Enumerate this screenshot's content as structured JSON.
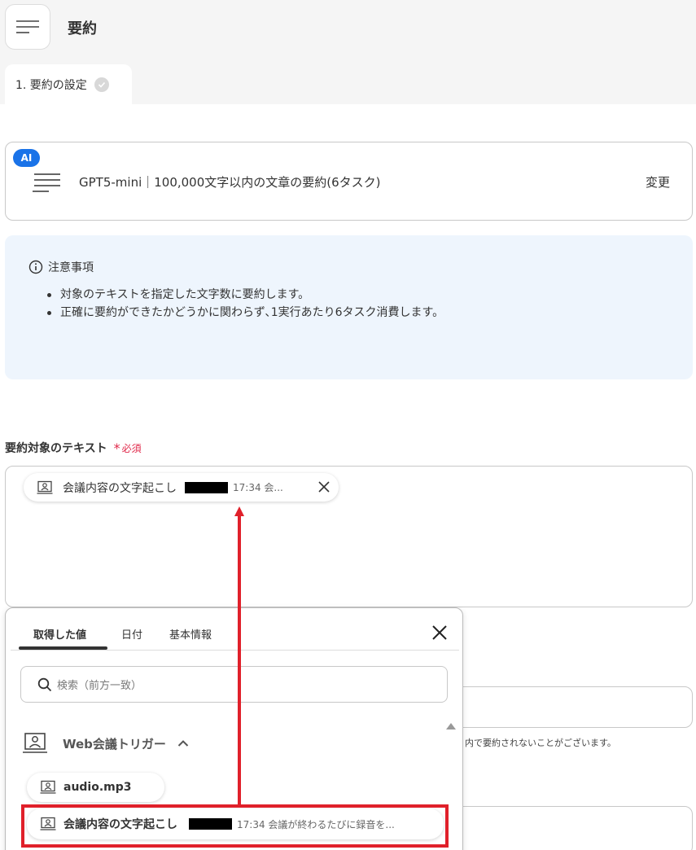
{
  "header": {
    "title": "要約"
  },
  "steps": [
    {
      "label": "1. 要約の設定"
    }
  ],
  "model": {
    "badge": "AI",
    "description": "GPT5-mini｜100,000文字以内の文章の要約(6タスク)",
    "change_label": "変更"
  },
  "notice": {
    "title": "注意事項",
    "items": [
      "対象のテキストを指定した文字数に要約します。",
      "正確に要約ができたかどうかに関わらず､1実行あたり6タスク消費します。"
    ]
  },
  "field": {
    "label": "要約対象のテキスト",
    "required": "必須",
    "chip": {
      "text": "会議内容の文字起こし",
      "time": "17:34 会..."
    }
  },
  "background_note": "内で要約されないことがございます。",
  "dropdown": {
    "tabs": [
      "取得した値",
      "日付",
      "基本情報"
    ],
    "active_tab": 0,
    "search_placeholder": "検索（前方一致）",
    "group": {
      "label": "Web会議トリガー",
      "expanded": true
    },
    "items": [
      {
        "text": "audio.mp3",
        "time": ""
      },
      {
        "text": "会議内容の文字起こし",
        "time": "17:34 会議が終わるたびに録音を..."
      }
    ]
  },
  "colors": {
    "accent_blue": "#1a73e8",
    "required_red": "#e0284a",
    "annotation_red": "#e0202a",
    "notice_bg": "#eef5fd"
  }
}
